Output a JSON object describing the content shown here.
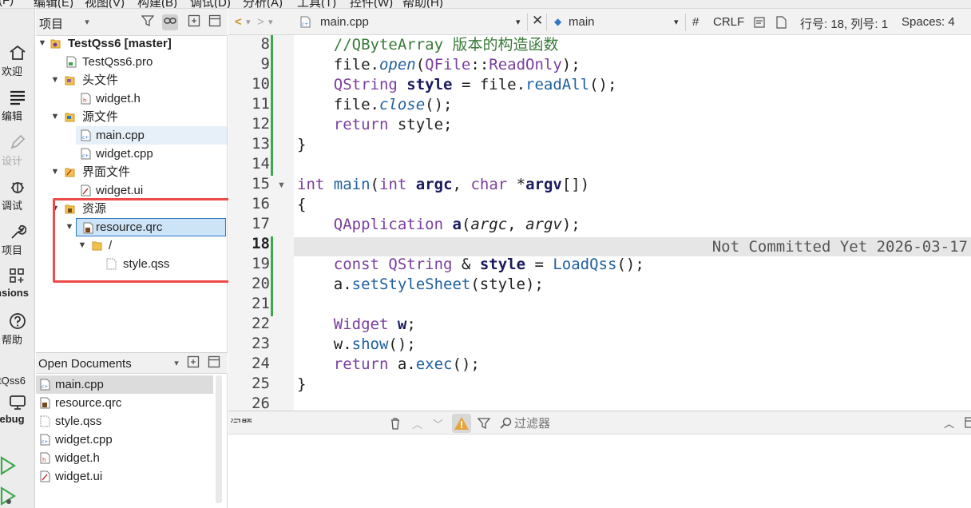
{
  "menubar": {
    "items": [
      "(F)",
      "编辑(E)",
      "视图(V)",
      "构建(B)",
      "调试(D)",
      "分析(A)",
      "工具(T)",
      "控件(W)",
      "帮助(H)"
    ]
  },
  "modes": [
    {
      "label": "欢迎",
      "icon": "home-icon"
    },
    {
      "label": "编辑",
      "icon": "edit-lines-icon"
    },
    {
      "label": "设计",
      "icon": "pen-icon"
    },
    {
      "label": "调试",
      "icon": "bug-icon"
    },
    {
      "label": "项目",
      "icon": "wrench-icon"
    },
    {
      "label": "nsions",
      "icon": "extensions-icon"
    },
    {
      "label": "帮助",
      "icon": "help-icon"
    },
    {
      "label": "tQss6",
      "icon": ""
    },
    {
      "label": "ebug",
      "icon": "monitor-icon"
    }
  ],
  "project_panel": {
    "title": "项目",
    "tree": {
      "root": "TestQss6 [master]",
      "pro_file": "TestQss6.pro",
      "headers_folder": "头文件",
      "header_file": "widget.h",
      "sources_folder": "源文件",
      "source_main": "main.cpp",
      "source_widget": "widget.cpp",
      "forms_folder": "界面文件",
      "form_file": "widget.ui",
      "resources_folder": "资源",
      "qrc_file": "resource.qrc",
      "prefix": "/",
      "qss_file": "style.qss"
    }
  },
  "open_documents": {
    "title": "Open Documents",
    "files": [
      "main.cpp",
      "resource.qrc",
      "style.qss",
      "widget.cpp",
      "widget.h",
      "widget.ui"
    ]
  },
  "editor_toolbar": {
    "file": "main.cpp",
    "symbol": "main",
    "hash": "#",
    "line_ending": "CRLF",
    "position": "行号: 18, 列号: 1",
    "indent": "Spaces: 4"
  },
  "editor": {
    "current_line": 18,
    "blame": "Not Committed Yet 2026-03-17",
    "line_numbers": [
      "8",
      "9",
      "10",
      "11",
      "12",
      "13",
      "14",
      "15",
      "16",
      "17",
      "18",
      "19",
      "20",
      "21",
      "22",
      "23",
      "24",
      "25",
      "26"
    ]
  },
  "issues": {
    "title": "问题",
    "filter_placeholder": "过滤器"
  },
  "colors": {
    "highlight_box": "#ef4a4a",
    "selection_border": "#2f78c2",
    "modified_marker": "#3aa84b",
    "run_button": "#3aa84b"
  }
}
